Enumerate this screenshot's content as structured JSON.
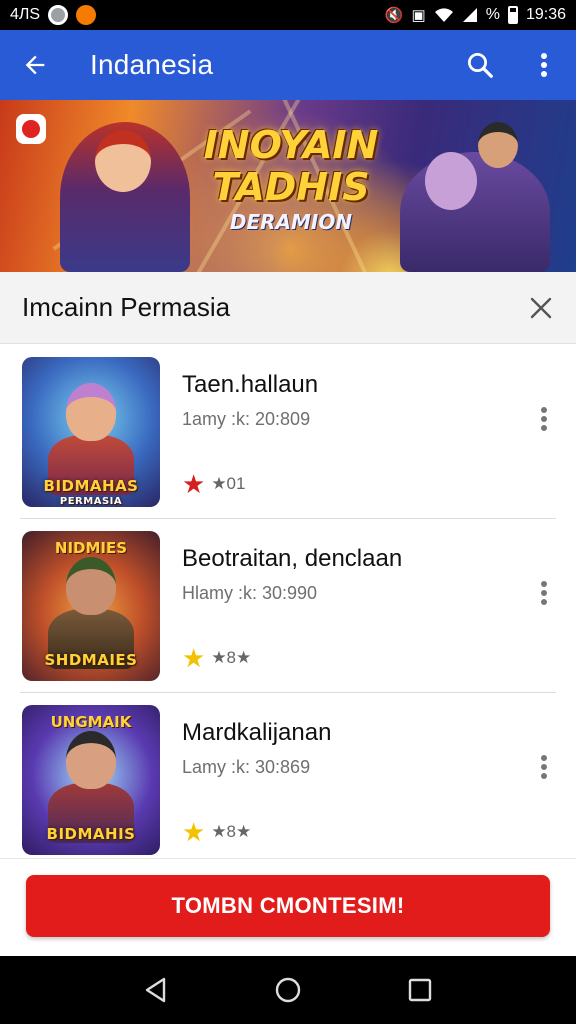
{
  "status_bar": {
    "left_text": "4ЛЅ",
    "time": "19:36",
    "signal_text": "%"
  },
  "app_bar": {
    "title": "Indanesia",
    "background": "#2a5bd7"
  },
  "banner": {
    "title_line1": "INOYAIN",
    "title_line2": "TADHIS",
    "title_line3": "DERAMION"
  },
  "section": {
    "title": "Imcainn Permasia"
  },
  "games": [
    {
      "title": "Taen.hallaun",
      "meta": "1amy :k: 20:809",
      "rating_text": "★01",
      "star_color": "#d62020",
      "thumb_label": "BIDMAHAS",
      "thumb_sub": "PERMASIA"
    },
    {
      "title": "Beotraitan, denclaan",
      "meta": "Hlamy :k: 30:990",
      "rating_text": "★8★",
      "star_color": "#f2c200",
      "thumb_label": "SHDMAIES",
      "thumb_top": "NIDMIES"
    },
    {
      "title": "Mardkalijanan",
      "meta": "Lamy :k: 30:869",
      "rating_text": "★8★",
      "star_color": "#f2c200",
      "thumb_label": "BIDMAHIS",
      "thumb_top": "UNGMAIK"
    }
  ],
  "cta": {
    "label": "TOMBN CMONTESIM!",
    "color": "#e21b1b"
  },
  "icons": {
    "back": "arrow-left-icon",
    "search": "search-icon",
    "more": "more-vert-icon",
    "close": "close-icon"
  }
}
